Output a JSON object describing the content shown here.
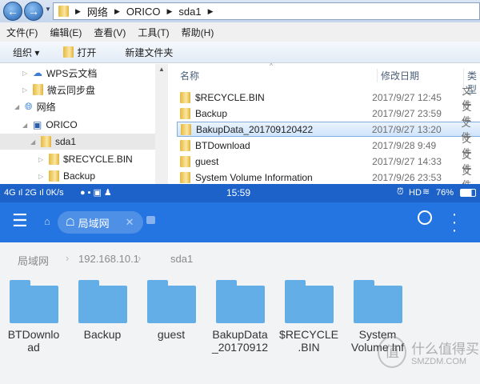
{
  "explorer": {
    "breadcrumb": [
      "网络",
      "ORICO",
      "sda1"
    ],
    "menu": [
      "文件(F)",
      "编辑(E)",
      "查看(V)",
      "工具(T)",
      "帮助(H)"
    ],
    "toolbar": {
      "organize": "组织 ▾",
      "open": "打开",
      "new_folder": "新建文件夹"
    },
    "tree": [
      {
        "label": "WPS云文档",
        "icon": "cloud-icon"
      },
      {
        "label": "微云同步盘",
        "icon": "folder-icon"
      },
      {
        "label": "网络",
        "icon": "network-icon"
      },
      {
        "label": "ORICO",
        "icon": "computer-icon"
      },
      {
        "label": "sda1",
        "icon": "share-folder-icon"
      },
      {
        "label": "$RECYCLE.BIN",
        "icon": "folder-icon"
      },
      {
        "label": "Backup",
        "icon": "folder-icon"
      }
    ],
    "columns": {
      "name": "名称",
      "modified": "修改日期",
      "type": "类型"
    },
    "files": [
      {
        "name": "$RECYCLE.BIN",
        "date": "2017/9/27 12:45",
        "type": "文件"
      },
      {
        "name": "Backup",
        "date": "2017/9/27 23:59",
        "type": "文件"
      },
      {
        "name": "BakupData_201709120422",
        "date": "2017/9/27 13:20",
        "type": "文件"
      },
      {
        "name": "BTDownload",
        "date": "2017/9/28 9:49",
        "type": "文件"
      },
      {
        "name": "guest",
        "date": "2017/9/27 14:33",
        "type": "文件"
      },
      {
        "name": "System Volume Information",
        "date": "2017/9/26 23:53",
        "type": "文件"
      }
    ]
  },
  "phone": {
    "status": {
      "left": "4G ıl 2G ıl 0K/s",
      "time": "15:59",
      "hd": "HD",
      "battery": "76%"
    },
    "tab_label": "局域网",
    "crumbs": [
      "局域网",
      "192.168.10.1",
      "sda1"
    ],
    "folders": [
      "BTDownlo\nad",
      "Backup",
      "guest",
      "BakupData\n_20170912",
      "$RECYCLE\n.BIN",
      "System\nVolume Inf"
    ],
    "colors": {
      "appbar": "#2475e2",
      "folder": "#64aee8"
    }
  },
  "watermark": {
    "text": "什么值得买",
    "domain": "SMZDM.COM"
  }
}
